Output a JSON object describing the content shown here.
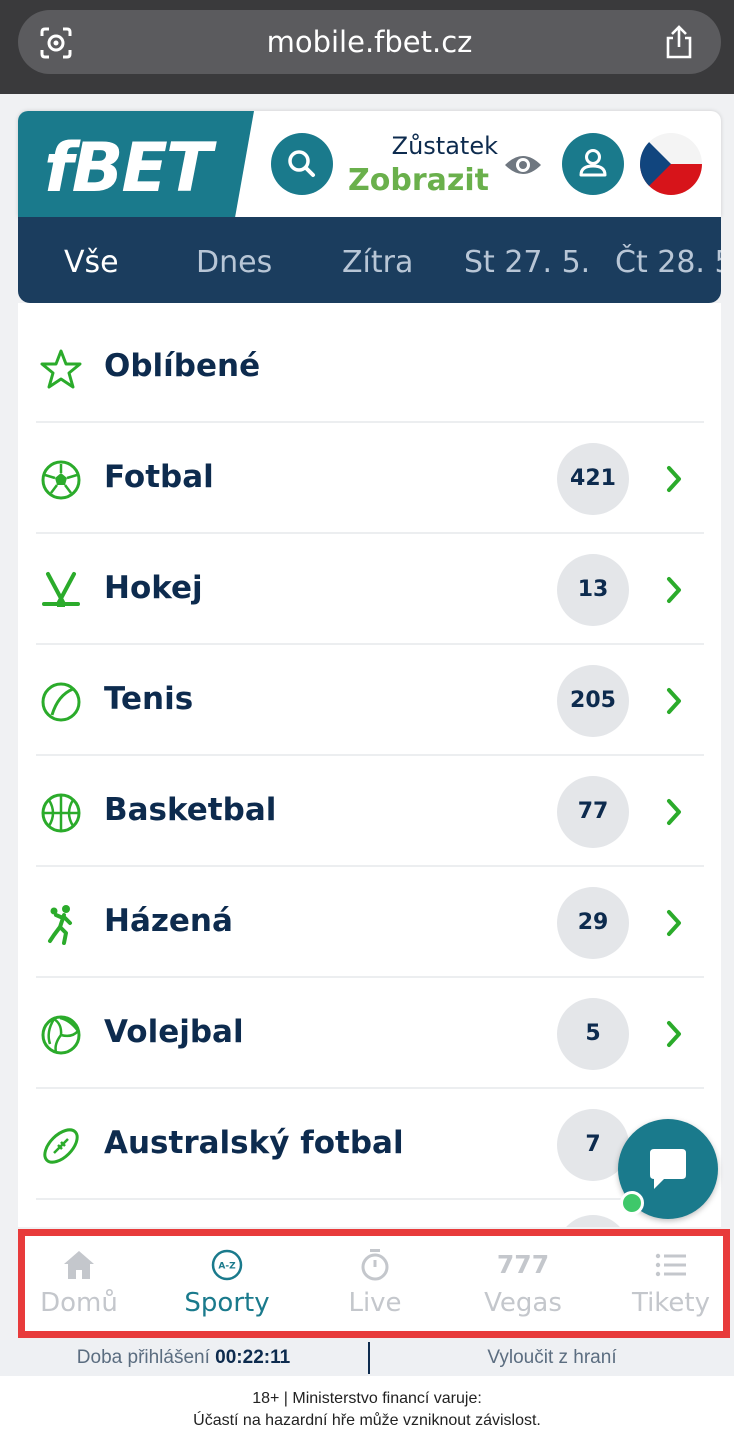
{
  "browser": {
    "url": "mobile.fbet.cz"
  },
  "header": {
    "logo": "fBET",
    "balance_label": "Zůstatek",
    "balance_action": "Zobrazit"
  },
  "date_tabs": [
    "Vše",
    "Dnes",
    "Zítra",
    "St 27. 5.",
    "Čt 28. 5"
  ],
  "favorites": {
    "label": "Oblíbené"
  },
  "sports": [
    {
      "label": "Fotbal",
      "count": "421",
      "icon": "soccer-ball-icon"
    },
    {
      "label": "Hokej",
      "count": "13",
      "icon": "hockey-sticks-icon"
    },
    {
      "label": "Tenis",
      "count": "205",
      "icon": "tennis-ball-icon"
    },
    {
      "label": "Basketbal",
      "count": "77",
      "icon": "basketball-icon"
    },
    {
      "label": "Házená",
      "count": "29",
      "icon": "handball-player-icon"
    },
    {
      "label": "Volejbal",
      "count": "5",
      "icon": "volleyball-icon"
    },
    {
      "label": "Australský fotbal",
      "count": "7",
      "icon": "rugby-ball-icon"
    }
  ],
  "nav": [
    {
      "label": "Domů",
      "icon": "home-icon"
    },
    {
      "label": "Sporty",
      "icon": "a-z-icon",
      "active": true
    },
    {
      "label": "Live",
      "icon": "stopwatch-icon"
    },
    {
      "label": "Vegas",
      "icon": "777-icon",
      "icon_text": "777"
    },
    {
      "label": "Tikety",
      "icon": "list-icon"
    }
  ],
  "session": {
    "label": "Doba přihlášení",
    "time": "00:22:11",
    "exclude": "Vyloučit z hraní"
  },
  "warning": {
    "line1": "18+ | Ministerstvo financí varuje:",
    "line2": "Účastí na hazardní hře může vzniknout závislost."
  },
  "colors": {
    "brand": "#1a7a8c",
    "accent_green": "#6ab04c",
    "navy": "#1b3d5e",
    "highlight": "#e83b3b"
  }
}
